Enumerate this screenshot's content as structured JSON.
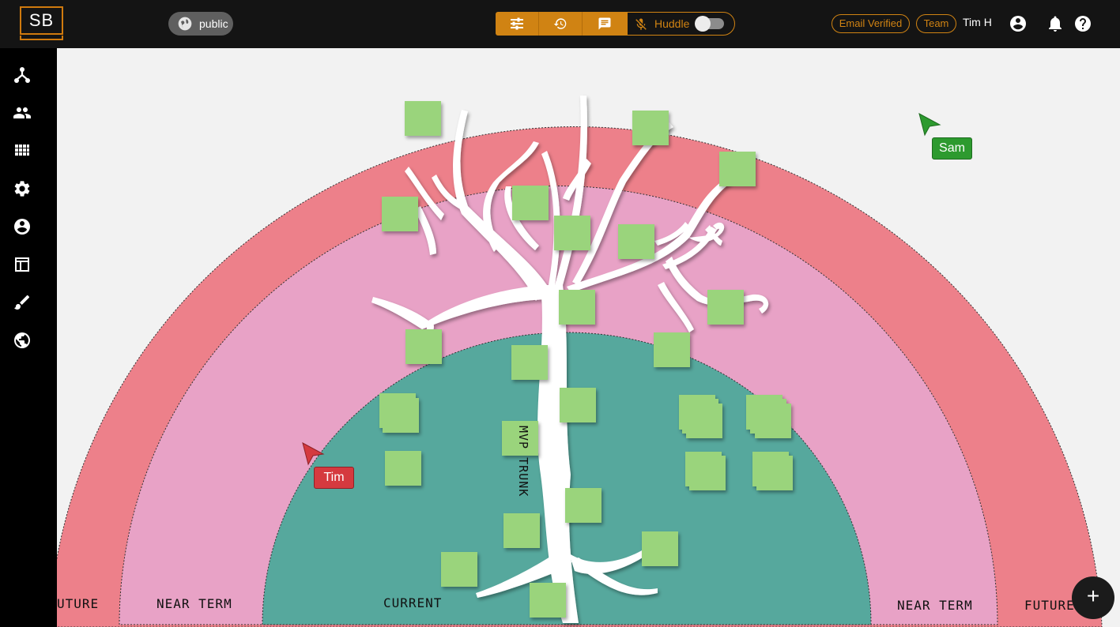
{
  "app": {
    "logo_text": "SB",
    "access_label": "public",
    "huddle_label": "Huddle",
    "huddle_enabled": false,
    "email_badge": "Email Verified",
    "team_badge": "Team",
    "user_name": "Tim H",
    "add_button_label": "+"
  },
  "toolbar": {
    "icons": [
      "sliders-icon",
      "history-icon",
      "chat-icon"
    ],
    "mic_icon": "mic-off-icon"
  },
  "header_icons": [
    "account-icon",
    "bell-icon",
    "help-icon"
  ],
  "sidebar": {
    "items": [
      {
        "icon": "hierarchy-icon"
      },
      {
        "icon": "people-icon"
      },
      {
        "icon": "grid-icon"
      },
      {
        "icon": "gear-icon"
      },
      {
        "icon": "account-icon"
      },
      {
        "icon": "table-icon"
      },
      {
        "icon": "brush-icon"
      },
      {
        "icon": "globe-icon"
      }
    ]
  },
  "board": {
    "zones": {
      "future_left": "UTURE",
      "near_term_left": "NEAR TERM",
      "current": "CURRENT",
      "near_term_right": "NEAR TERM",
      "future_right": "FUTURE"
    },
    "trunk_label": "MVP TRUNK",
    "colors": {
      "future": "#ed808a",
      "near_term": "#e8a2c6",
      "current": "#56a89d",
      "sticky": "#9ad47c",
      "tree": "#ffffff"
    }
  },
  "cursors": [
    {
      "name": "Sam",
      "color": "#2d9a2f"
    },
    {
      "name": "Tim",
      "color": "#d53a3f"
    }
  ]
}
